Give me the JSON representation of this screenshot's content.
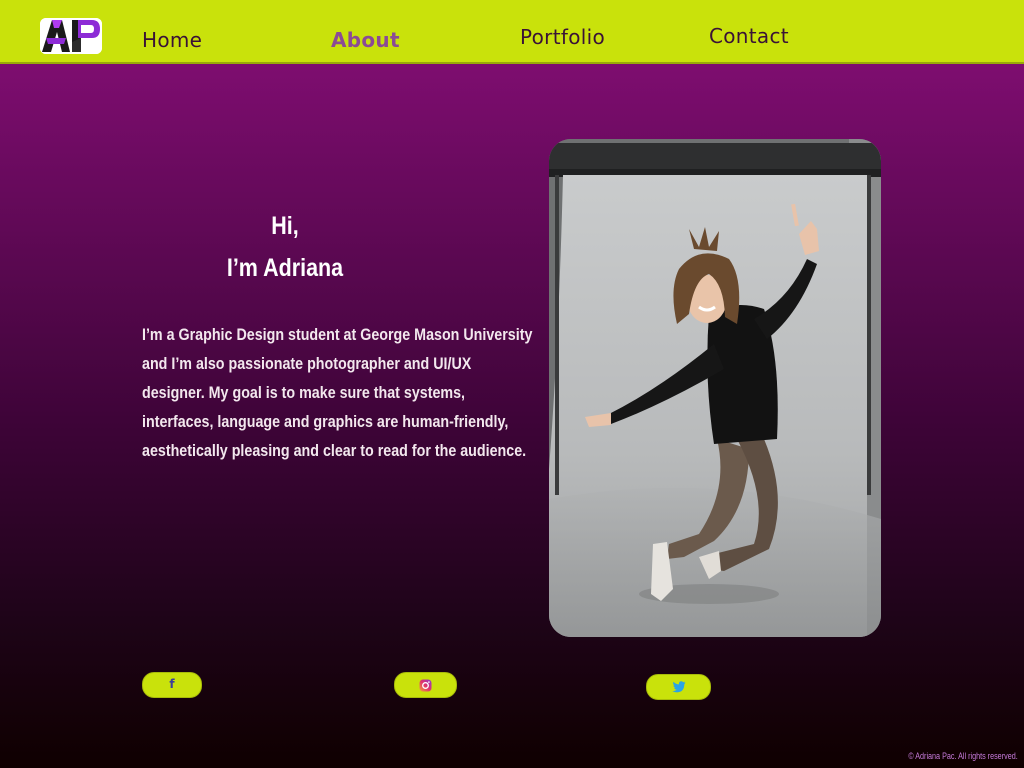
{
  "nav": {
    "items": [
      {
        "label": "Home"
      },
      {
        "label": "About"
      },
      {
        "label": "Portfolio"
      },
      {
        "label": "Contact"
      }
    ],
    "active": "About"
  },
  "hero": {
    "greeting_line1": "Hi,",
    "greeting_line2": "I’m Adriana",
    "intro": "I’m a Graphic Design student at George Mason University and I’m also passionate photographer and  UI/UX designer. My goal is to make sure that systems, interfaces, language and graphics are human-friendly, aesthetically pleasing and clear to read for the audience."
  },
  "social": {
    "facebook_icon": "facebook-icon",
    "instagram_icon": "instagram-icon",
    "twitter_icon": "twitter-icon"
  },
  "footer": {
    "copyright": "© Adriana Pac. All rights reserved."
  },
  "colors": {
    "nav_bg": "#c9e20b",
    "active_link": "#8b4b95",
    "page_gradient_top": "#8a0f7a",
    "page_gradient_bottom": "#0f0000",
    "copyright": "#c77bdc"
  }
}
